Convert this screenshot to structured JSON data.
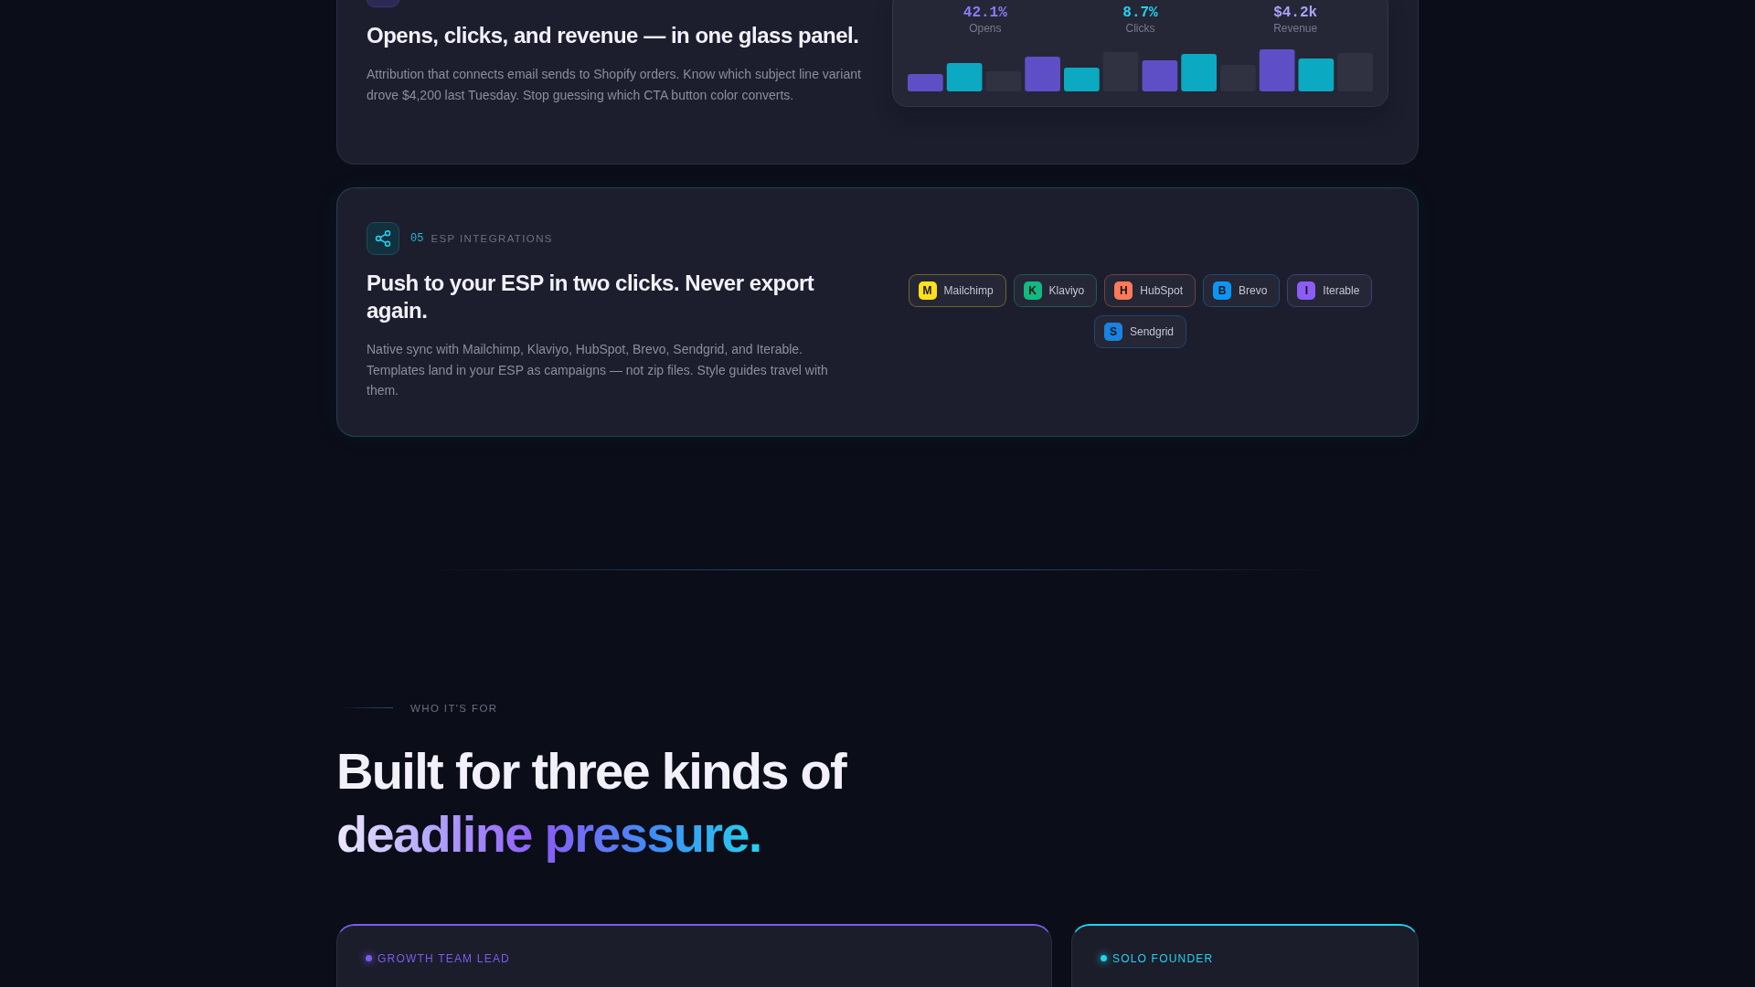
{
  "analytics": {
    "heading": "Opens, clicks, and revenue — in one glass panel.",
    "description": "Attribution that connects email sends to Shopify orders. Know which subject line variant drove $4,200 last Tuesday. Stop guessing which CTA button color converts.",
    "stats": [
      {
        "value": "42.1%",
        "label": "Opens",
        "color": "#8b7cf6"
      },
      {
        "value": "8.7%",
        "label": "Clicks",
        "color": "#22d3ee"
      },
      {
        "value": "$4.2k",
        "label": "Revenue",
        "color": "#a9a3f7"
      }
    ]
  },
  "integrations": {
    "number": "05",
    "label": "ESP INTEGRATIONS",
    "heading": "Push to your ESP in two clicks. Never export again.",
    "description": "Native sync with Mailchimp, Klaviyo, HubSpot, Brevo, Sendgrid, and Iterable. Templates land in your ESP as campaigns — not zip files. Style guides travel with them.",
    "chips": [
      {
        "letter": "M",
        "name": "Mailchimp",
        "color": "#ffe01b"
      },
      {
        "letter": "K",
        "name": "Klaviyo",
        "color": "#12b981"
      },
      {
        "letter": "H",
        "name": "HubSpot",
        "color": "#ff7a59"
      },
      {
        "letter": "B",
        "name": "Brevo",
        "color": "#0b96f5"
      },
      {
        "letter": "I",
        "name": "Iterable",
        "color": "#8b5cf6"
      },
      {
        "letter": "S",
        "name": "Sendgrid",
        "color": "#1a82e2"
      }
    ]
  },
  "audience": {
    "eyebrow": "WHO IT'S FOR",
    "heading_lines": [
      {
        "text": "Built for three kinds of",
        "gradient": false
      },
      {
        "text": "deadline pressure.",
        "gradient": true
      }
    ],
    "cards": [
      {
        "label": "GROWTH TEAM LEAD",
        "color": "#7c5cf0"
      },
      {
        "label": "SOLO FOUNDER",
        "color": "#22d3ee"
      }
    ]
  }
}
